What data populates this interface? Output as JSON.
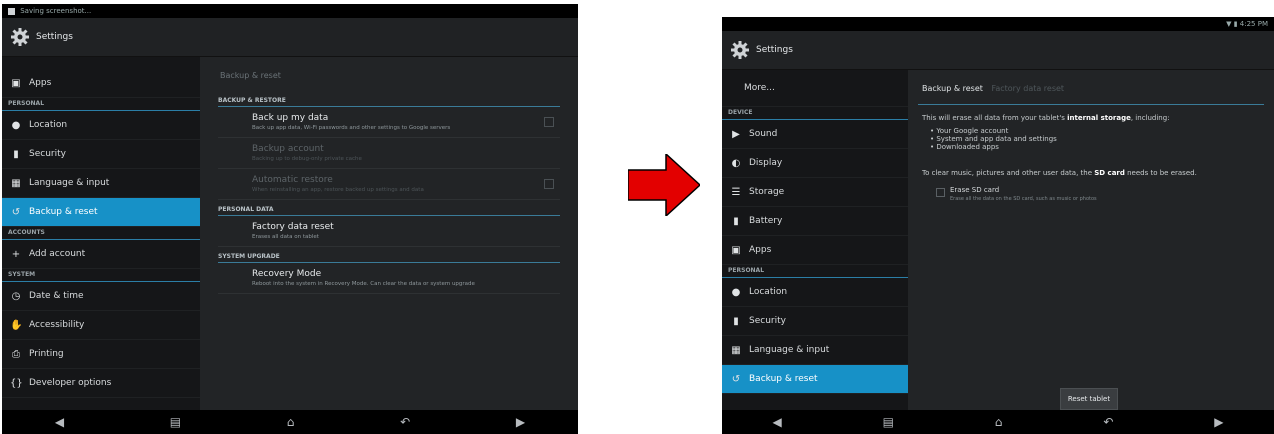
{
  "colors": {
    "accent": "#1791c7",
    "arrow": "#e30000",
    "background": "#1b1d1f"
  },
  "left": {
    "status": {
      "notification": "Saving screenshot..."
    },
    "app_title": "Settings",
    "sidebar": {
      "items": [
        {
          "icon": "apps-icon",
          "label": "Apps"
        }
      ],
      "header_personal": "PERSONAL",
      "personal": [
        {
          "icon": "location-icon",
          "label": "Location"
        },
        {
          "icon": "lock-icon",
          "label": "Security"
        },
        {
          "icon": "language-icon",
          "label": "Language & input"
        },
        {
          "icon": "backup-icon",
          "label": "Backup & reset"
        }
      ],
      "header_accounts": "ACCOUNTS",
      "accounts": [
        {
          "icon": "plus-icon",
          "label": "Add account"
        }
      ],
      "header_system": "SYSTEM",
      "system": [
        {
          "icon": "clock-icon",
          "label": "Date & time"
        },
        {
          "icon": "hand-icon",
          "label": "Accessibility"
        },
        {
          "icon": "printer-icon",
          "label": "Printing"
        },
        {
          "icon": "developer-icon",
          "label": "Developer options"
        }
      ]
    },
    "main": {
      "breadcrumb": "Backup & reset",
      "header_backup": "BACKUP & RESTORE",
      "backup_my_data": {
        "title": "Back up my data",
        "summary": "Back up app data, Wi-Fi passwords and other settings to Google servers"
      },
      "backup_account": {
        "title": "Backup account",
        "summary": "Backing up to debug-only private cache"
      },
      "auto_restore": {
        "title": "Automatic restore",
        "summary": "When reinstalling an app, restore backed up settings and data"
      },
      "header_personal": "PERSONAL DATA",
      "factory_reset": {
        "title": "Factory data reset",
        "summary": "Erases all data on tablet"
      },
      "header_system": "SYSTEM UPGRADE",
      "recovery": {
        "title": "Recovery Mode",
        "summary": "Reboot into the system in Recovery Mode. Can clear the data or system upgrade"
      }
    }
  },
  "right": {
    "status": {
      "time": "4:25 PM"
    },
    "app_title": "Settings",
    "sidebar": {
      "more": "More...",
      "header_device": "DEVICE",
      "device": [
        {
          "icon": "sound-icon",
          "label": "Sound"
        },
        {
          "icon": "display-icon",
          "label": "Display"
        },
        {
          "icon": "storage-icon",
          "label": "Storage"
        },
        {
          "icon": "battery-icon",
          "label": "Battery"
        },
        {
          "icon": "apps-icon",
          "label": "Apps"
        }
      ],
      "header_personal": "PERSONAL",
      "personal": [
        {
          "icon": "location-icon",
          "label": "Location"
        },
        {
          "icon": "lock-icon",
          "label": "Security"
        },
        {
          "icon": "language-icon",
          "label": "Language & input"
        },
        {
          "icon": "backup-icon",
          "label": "Backup & reset"
        }
      ]
    },
    "main": {
      "breadcrumb": "Backup & reset",
      "breadcrumb_sub": "Factory data reset",
      "warning_pre": "This will erase all data from your tablet's ",
      "warning_bold": "internal storage",
      "warning_post": ", including:",
      "bullets": [
        "Your Google account",
        "System and app data and settings",
        "Downloaded apps"
      ],
      "sd_pre": "To clear music, pictures and other user data, the ",
      "sd_bold": "SD card",
      "sd_post": " needs to be erased.",
      "erase_title": "Erase SD card",
      "erase_summary": "Erase all the data on the SD card, such as music or photos",
      "reset_button": "Reset tablet"
    }
  }
}
